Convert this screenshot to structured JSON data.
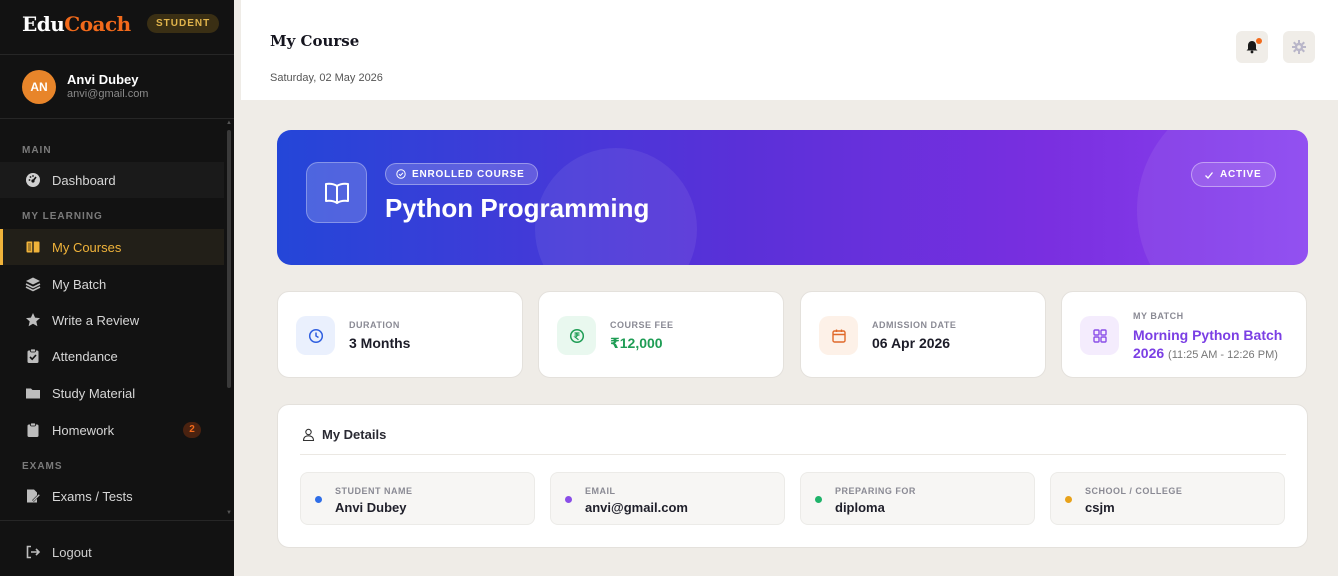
{
  "brand": {
    "name_part1": "Edu",
    "name_part2": "Coach",
    "role_badge": "STUDENT"
  },
  "user": {
    "initials": "AN",
    "name": "Anvi Dubey",
    "email": "anvi@gmail.com"
  },
  "sidebar": {
    "sections": {
      "main": "MAIN",
      "learning": "MY LEARNING",
      "exams": "EXAMS"
    },
    "items": [
      {
        "label": "Dashboard",
        "icon": "dashboard-gauge-icon"
      },
      {
        "label": "My Courses",
        "icon": "book-icon",
        "active": true
      },
      {
        "label": "My Batch",
        "icon": "layers-icon"
      },
      {
        "label": "Write a Review",
        "icon": "star-icon"
      },
      {
        "label": "Attendance",
        "icon": "clipboard-check-icon"
      },
      {
        "label": "Study Material",
        "icon": "folder-icon"
      },
      {
        "label": "Homework",
        "icon": "clipboard-icon",
        "badge": "2"
      },
      {
        "label": "Exams / Tests",
        "icon": "edit-document-icon"
      }
    ],
    "logout": "Logout"
  },
  "header": {
    "title": "My Course",
    "date": "Saturday, 02 May 2026"
  },
  "hero": {
    "pill": "ENROLLED COURSE",
    "course": "Python Programming",
    "status": "ACTIVE"
  },
  "stats": {
    "duration": {
      "label": "DURATION",
      "value": "3 Months"
    },
    "fee": {
      "label": "COURSE FEE",
      "value": "₹12,000"
    },
    "admission": {
      "label": "ADMISSION DATE",
      "value": "06 Apr 2026"
    },
    "batch": {
      "label": "MY BATCH",
      "value": "Morning Python Batch 2026",
      "time": "(11:25 AM - 12:26 PM)"
    }
  },
  "details": {
    "title": "My Details",
    "student_name": {
      "label": "STUDENT NAME",
      "value": "Anvi Dubey"
    },
    "email": {
      "label": "EMAIL",
      "value": "anvi@gmail.com"
    },
    "preparing": {
      "label": "PREPARING FOR",
      "value": "diploma"
    },
    "school": {
      "label": "SCHOOL / COLLEGE",
      "value": "csjm"
    }
  },
  "colors": {
    "accent": "#f0b33a",
    "brand_orange": "#f26a1b",
    "hero_start": "#2446d8",
    "hero_end": "#8a44f0",
    "fee_green": "#1f9d55",
    "batch_purple": "#7b3fe4"
  }
}
